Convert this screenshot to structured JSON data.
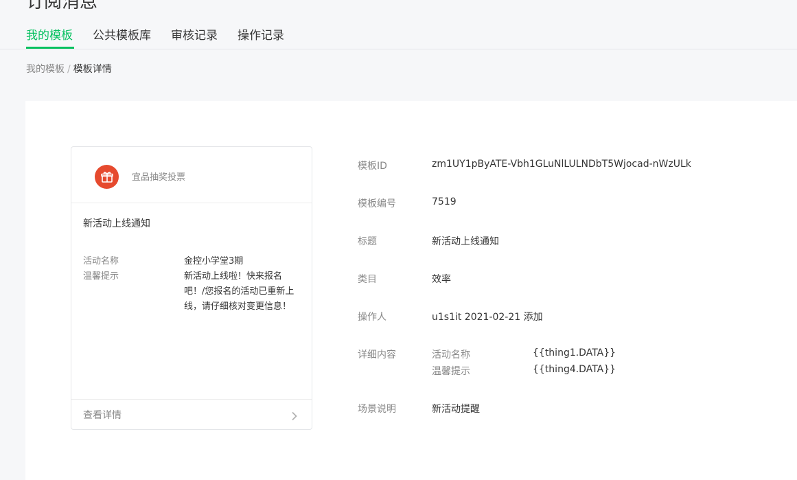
{
  "page": {
    "title": "订阅消息"
  },
  "tabs": [
    {
      "label": "我的模板",
      "active": true
    },
    {
      "label": "公共模板库",
      "active": false
    },
    {
      "label": "审核记录",
      "active": false
    },
    {
      "label": "操作记录",
      "active": false
    }
  ],
  "breadcrumb": {
    "parent": "我的模板",
    "separator": "/",
    "current": "模板详情"
  },
  "preview": {
    "app_icon": "gift-icon",
    "app_name": "宜品抽奖投票",
    "title": "新活动上线通知",
    "fields": [
      {
        "label": "活动名称",
        "value": "金控小学堂3期"
      },
      {
        "label": "温馨提示",
        "value": "新活动上线啦！快来报名吧！/您报名的活动已重新上线，请仔细核对变更信息！"
      }
    ],
    "footer_label": "查看详情",
    "footer_icon": "chevron-right-icon"
  },
  "info": {
    "template_id": {
      "label": "模板ID",
      "value": "zm1UY1pByATE-Vbh1GLuNlLULNDbT5Wjocad-nWzULk"
    },
    "template_no": {
      "label": "模板编号",
      "value": "7519"
    },
    "title": {
      "label": "标题",
      "value": "新活动上线通知"
    },
    "category": {
      "label": "类目",
      "value": "效率"
    },
    "operator": {
      "label": "操作人",
      "value": "u1s1it 2021-02-21 添加"
    },
    "details": {
      "label": "详细内容",
      "items": [
        {
          "name": "活动名称",
          "value": "{{thing1.DATA}}"
        },
        {
          "name": "温馨提示",
          "value": "{{thing4.DATA}}"
        }
      ]
    },
    "scene": {
      "label": "场景说明",
      "value": "新活动提醒"
    }
  },
  "colors": {
    "accent": "#07c160",
    "logo_bg": "#e64a2e",
    "muted_text": "#888888",
    "body_text": "#353535",
    "page_bg": "#f6f7f9"
  }
}
